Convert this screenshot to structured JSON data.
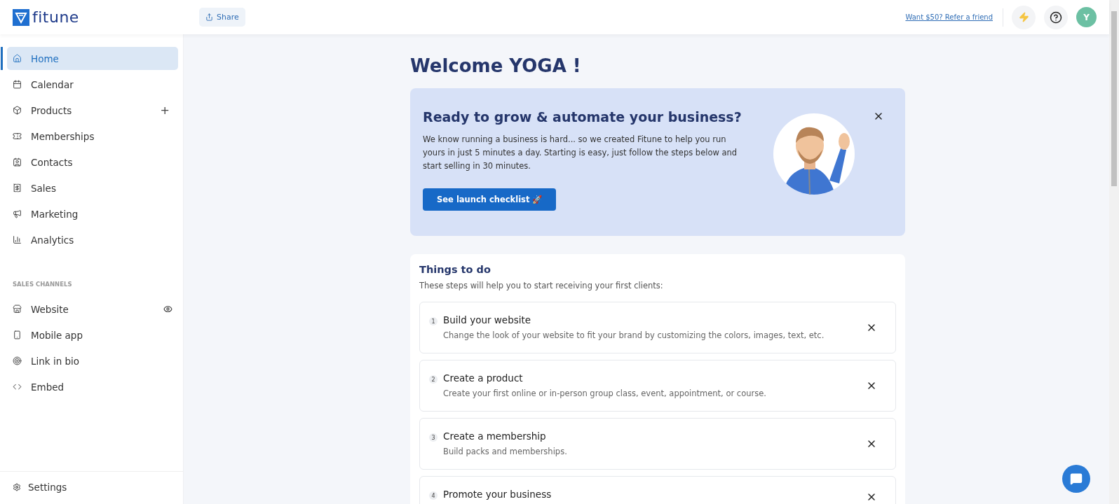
{
  "header": {
    "logo": "fitune",
    "share_button": "Share",
    "referral_link": "Want $50? Refer a friend",
    "avatar": "Y"
  },
  "sidebar": {
    "items": [
      {
        "label": "Home",
        "selected": true
      },
      {
        "label": "Calendar",
        "selected": false
      },
      {
        "label": "Products",
        "selected": false,
        "action": "+"
      },
      {
        "label": "Memberships",
        "selected": false
      },
      {
        "label": "Contacts",
        "selected": false
      },
      {
        "label": "Sales",
        "selected": false
      },
      {
        "label": "Marketing",
        "selected": false
      },
      {
        "label": "Analytics",
        "selected": false
      }
    ],
    "section_title": "SALES CHANNELS",
    "channels": [
      {
        "label": "Website",
        "selected": false,
        "preview": true
      },
      {
        "label": "Mobile app",
        "selected": false,
        "preview": false
      },
      {
        "label": "Link in bio",
        "selected": false,
        "preview": false
      },
      {
        "label": "Embed",
        "selected": false,
        "preview": false
      }
    ],
    "settings": "Settings"
  },
  "main": {
    "title": "Welcome YOGA !",
    "banner": {
      "title": "Ready to grow & automate your business?",
      "text": "We know running a business is hard... so we created Fitune to help you run yours in just 5 minutes a day. Starting is easy, just follow the steps below and start selling in 30 minutes.",
      "button": "See launch checklist 🚀"
    },
    "todo": {
      "title": "Things to do",
      "subtitle": "These steps will help you to start receiving your first clients:",
      "steps": [
        {
          "number": "1",
          "title": "Build your website",
          "description": "Change the look of your website to fit your brand by customizing the colors, images, text, etc."
        },
        {
          "number": "2",
          "title": "Create a product",
          "description": "Create your first online or in-person group class, event, appointment, or course."
        },
        {
          "number": "3",
          "title": "Create a membership",
          "description": "Build packs and memberships."
        },
        {
          "number": "4",
          "title": "Promote your business"
        }
      ]
    }
  }
}
